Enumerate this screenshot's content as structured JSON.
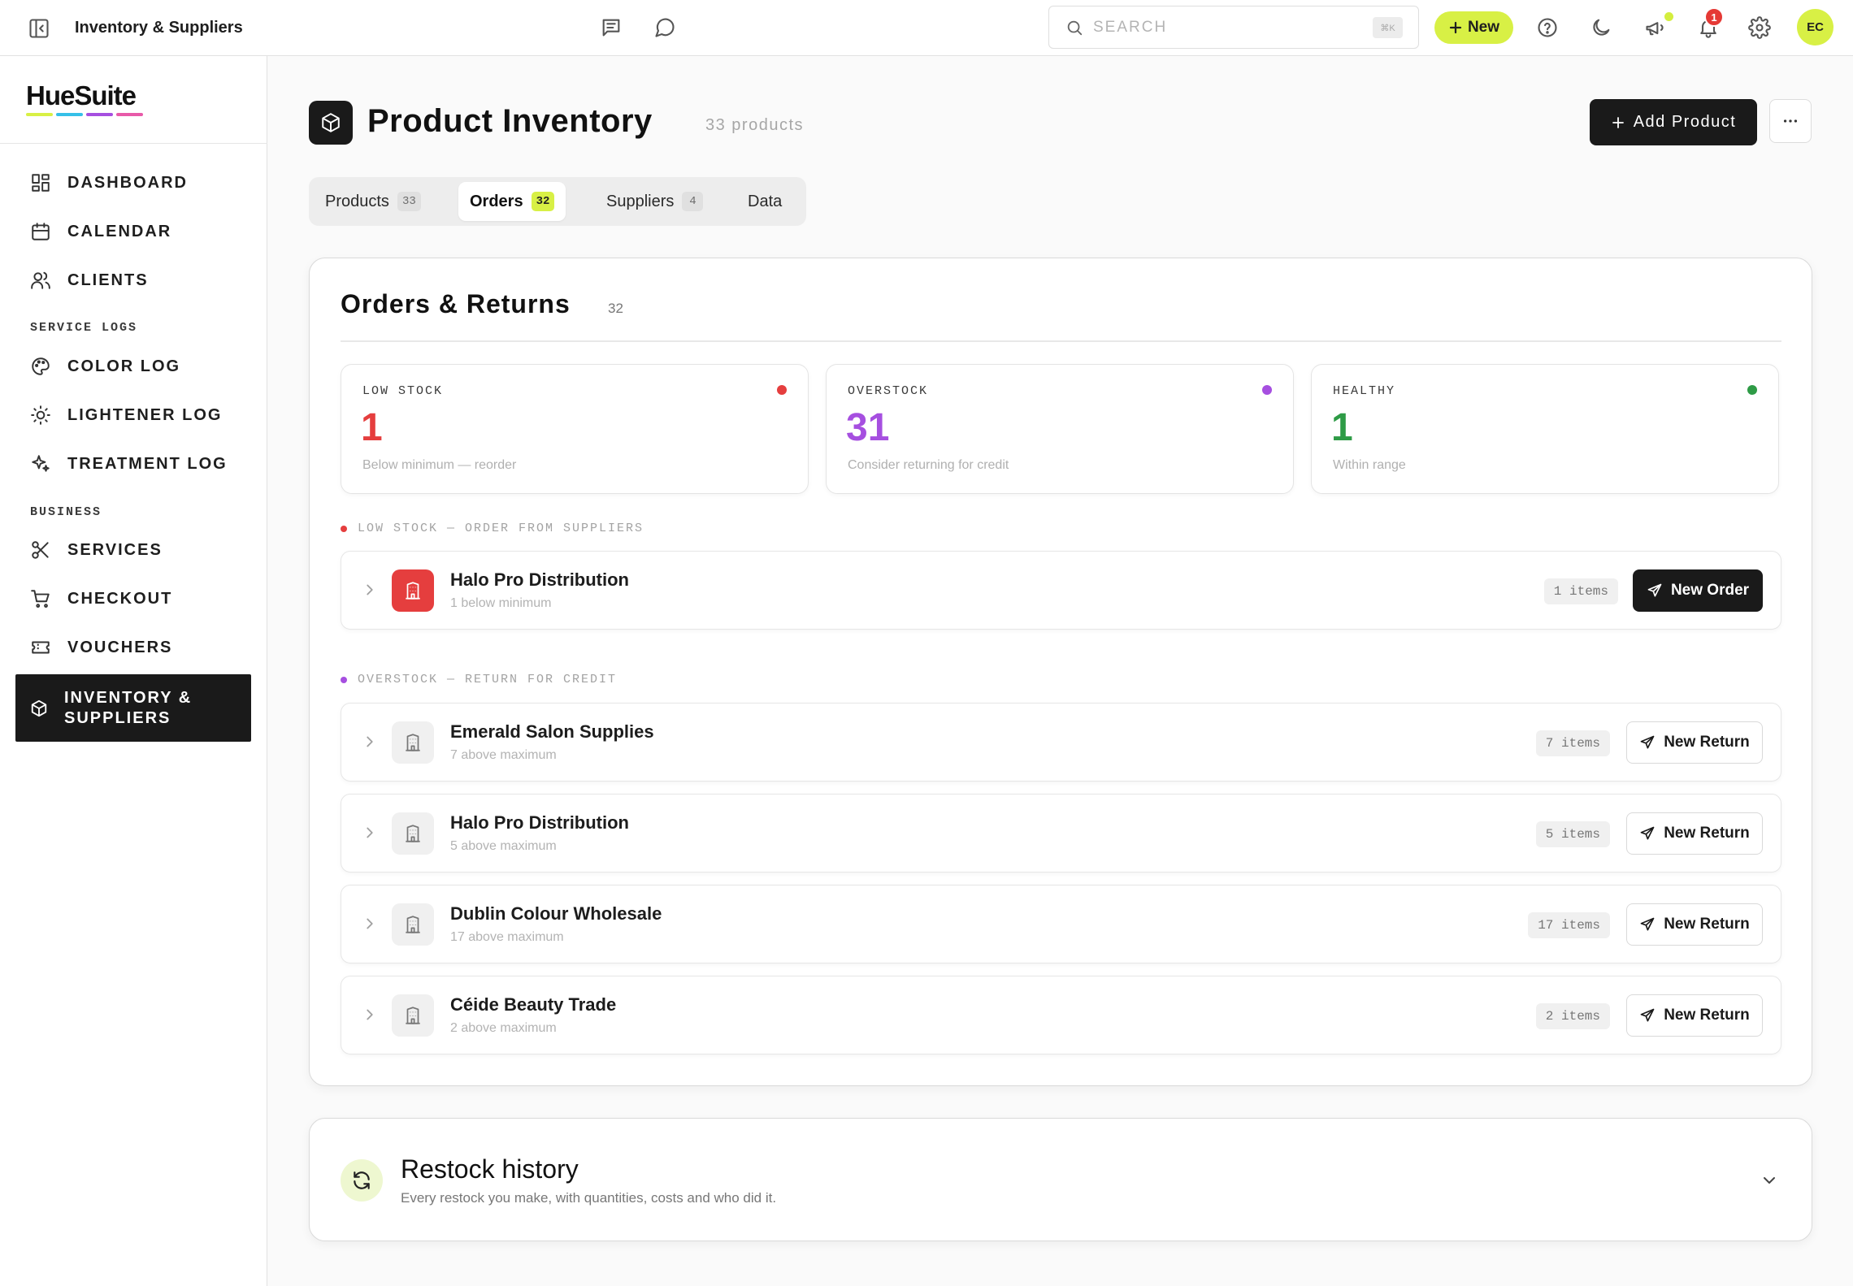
{
  "topbar": {
    "title": "Inventory & Suppliers",
    "search_placeholder": "SEARCH",
    "search_shortcut": "⌘K",
    "new_label": "New",
    "notification_count": "1",
    "avatar_initials": "EC",
    "accent": "#d8f045"
  },
  "sidebar": {
    "logo": "HueSuite",
    "logo_colors": [
      "#d8f045",
      "#35c0e8",
      "#a64fe0",
      "#e85aa9"
    ],
    "items": [
      {
        "label": "DASHBOARD",
        "icon": "dashboard-icon"
      },
      {
        "label": "CALENDAR",
        "icon": "calendar-icon"
      },
      {
        "label": "CLIENTS",
        "icon": "users-icon"
      }
    ],
    "section_service": "SERVICE LOGS",
    "service_items": [
      {
        "label": "COLOR LOG",
        "icon": "palette-icon"
      },
      {
        "label": "LIGHTENER LOG",
        "icon": "sun-icon"
      },
      {
        "label": "TREATMENT LOG",
        "icon": "sparkles-icon"
      }
    ],
    "section_business": "BUSINESS",
    "business_items": [
      {
        "label": "SERVICES",
        "icon": "scissors-icon"
      },
      {
        "label": "CHECKOUT",
        "icon": "cart-icon"
      },
      {
        "label": "VOUCHERS",
        "icon": "ticket-icon"
      },
      {
        "label": "INVENTORY & SUPPLIERS",
        "icon": "box-icon",
        "active": true
      }
    ]
  },
  "header": {
    "title": "Product Inventory",
    "count": "33 products",
    "add_label": "Add Product"
  },
  "tabs": [
    {
      "label": "Products",
      "badge": "33"
    },
    {
      "label": "Orders",
      "badge": "32",
      "active": true
    },
    {
      "label": "Suppliers",
      "badge": "4"
    },
    {
      "label": "Data",
      "badge": ""
    }
  ],
  "orders": {
    "title": "Orders & Returns",
    "count": "32",
    "stats": [
      {
        "label": "LOW STOCK",
        "value": "1",
        "desc": "Below minimum — reorder",
        "color": "#e53e3e"
      },
      {
        "label": "OVERSTOCK",
        "value": "31",
        "desc": "Consider returning for credit",
        "color": "#a64fe0"
      },
      {
        "label": "HEALTHY",
        "value": "1",
        "desc": "Within range",
        "color": "#2e9b46"
      }
    ],
    "low_group_label": "LOW STOCK — ORDER FROM SUPPLIERS",
    "low_rows": [
      {
        "name": "Halo Pro Distribution",
        "sub": "1 below minimum",
        "items": "1 items",
        "action": "New Order"
      }
    ],
    "over_group_label": "OVERSTOCK — RETURN FOR CREDIT",
    "over_rows": [
      {
        "name": "Emerald Salon Supplies",
        "sub": "7 above maximum",
        "items": "7 items",
        "action": "New Return"
      },
      {
        "name": "Halo Pro Distribution",
        "sub": "5 above maximum",
        "items": "5 items",
        "action": "New Return"
      },
      {
        "name": "Dublin Colour Wholesale",
        "sub": "17 above maximum",
        "items": "17 items",
        "action": "New Return"
      },
      {
        "name": "Céide Beauty Trade",
        "sub": "2 above maximum",
        "items": "2 items",
        "action": "New Return"
      }
    ]
  },
  "restock": {
    "title": "Restock history",
    "subtitle": "Every restock you make, with quantities, costs and who did it."
  }
}
